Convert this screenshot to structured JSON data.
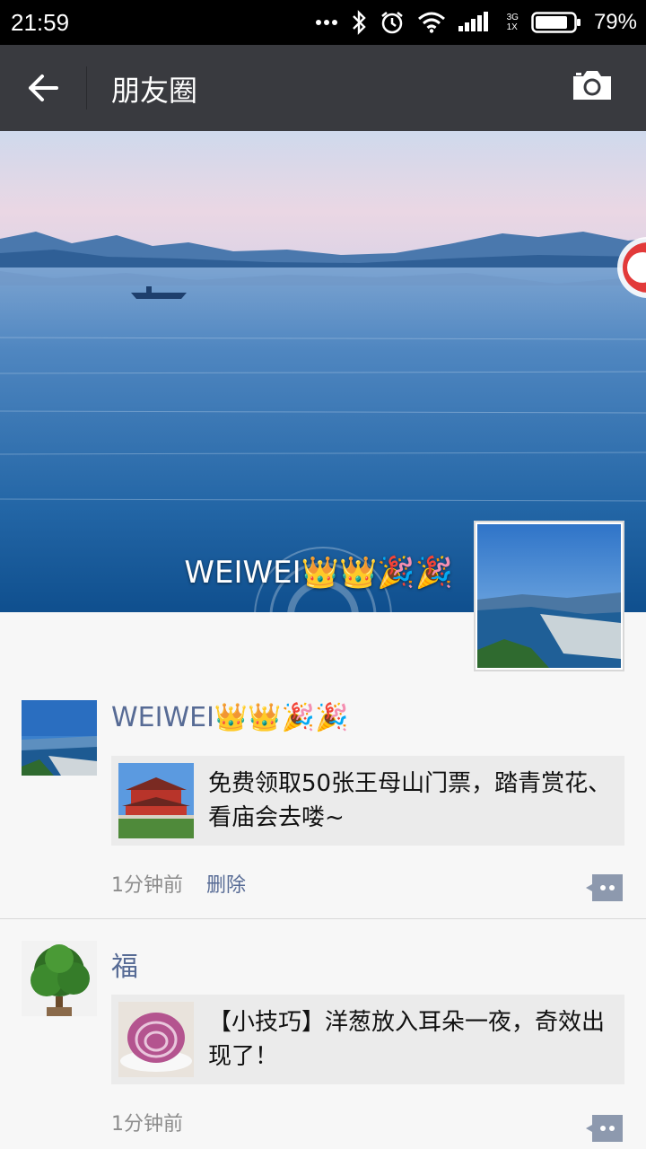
{
  "status_bar": {
    "time": "21:59",
    "battery_percent": "79%",
    "network_type_top": "3G",
    "network_type_bottom": "1X",
    "icons": [
      "more-dots-icon",
      "bluetooth-icon",
      "alarm-icon",
      "wifi-icon",
      "signal-icon",
      "battery-icon"
    ]
  },
  "header": {
    "title": "朋友圈",
    "back_icon": "back-arrow-icon",
    "camera_icon": "camera-icon"
  },
  "cover": {
    "owner_name": "WEIWEI👑👑🎉🎉"
  },
  "posts": [
    {
      "name": "WEIWEI👑👑🎉🎉",
      "link_text": "免费领取50张王母山门票，踏青赏花、看庙会去喽~",
      "time": "1分钟前",
      "delete_label": "删除"
    },
    {
      "name": "福",
      "link_text": "【小技巧】洋葱放入耳朵一夜，奇效出现了！",
      "time": "1分钟前"
    }
  ],
  "colors": {
    "header_bg": "#393a3f",
    "name_link": "#576b95",
    "card_bg": "#ebebeb",
    "page_bg": "#f7f7f7"
  }
}
